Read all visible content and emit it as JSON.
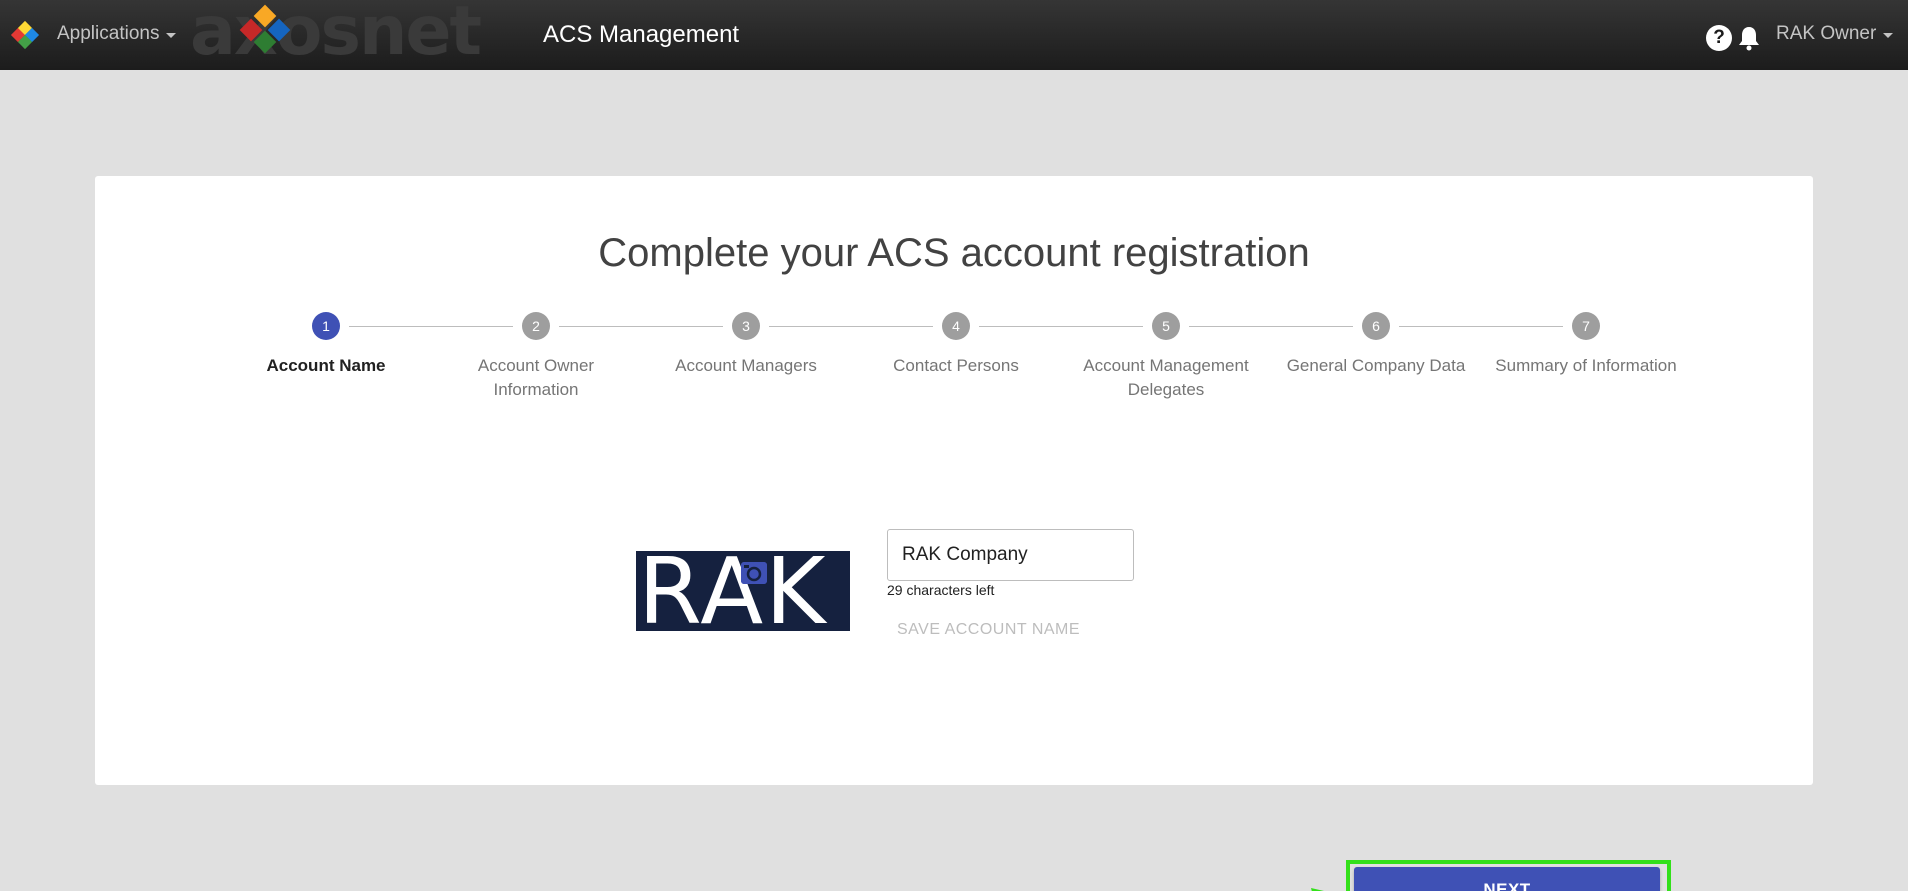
{
  "topbar": {
    "apps_label": "Applications",
    "brand_text": "axosnet",
    "title": "ACS Management",
    "help_glyph": "?",
    "user_label": "RAK Owner"
  },
  "card": {
    "title": "Complete your ACS account registration",
    "steps": [
      {
        "number": "1",
        "label": "Account Name",
        "active": true
      },
      {
        "number": "2",
        "label": "Account Owner Information",
        "active": false
      },
      {
        "number": "3",
        "label": "Account Managers",
        "active": false
      },
      {
        "number": "4",
        "label": "Contact Persons",
        "active": false
      },
      {
        "number": "5",
        "label": "Account Management Delegates",
        "active": false
      },
      {
        "number": "6",
        "label": "General Company Data",
        "active": false
      },
      {
        "number": "7",
        "label": "Summary of Information",
        "active": false
      }
    ]
  },
  "account": {
    "logo_text": "RAK",
    "name_value": "RAK Company",
    "chars_left": "29 characters left",
    "save_label": "SAVE ACCOUNT NAME",
    "next_label": "NEXT"
  },
  "colors": {
    "primary": "#3f51b5",
    "highlight": "#33e01a",
    "logo_bg": "#15213f"
  }
}
